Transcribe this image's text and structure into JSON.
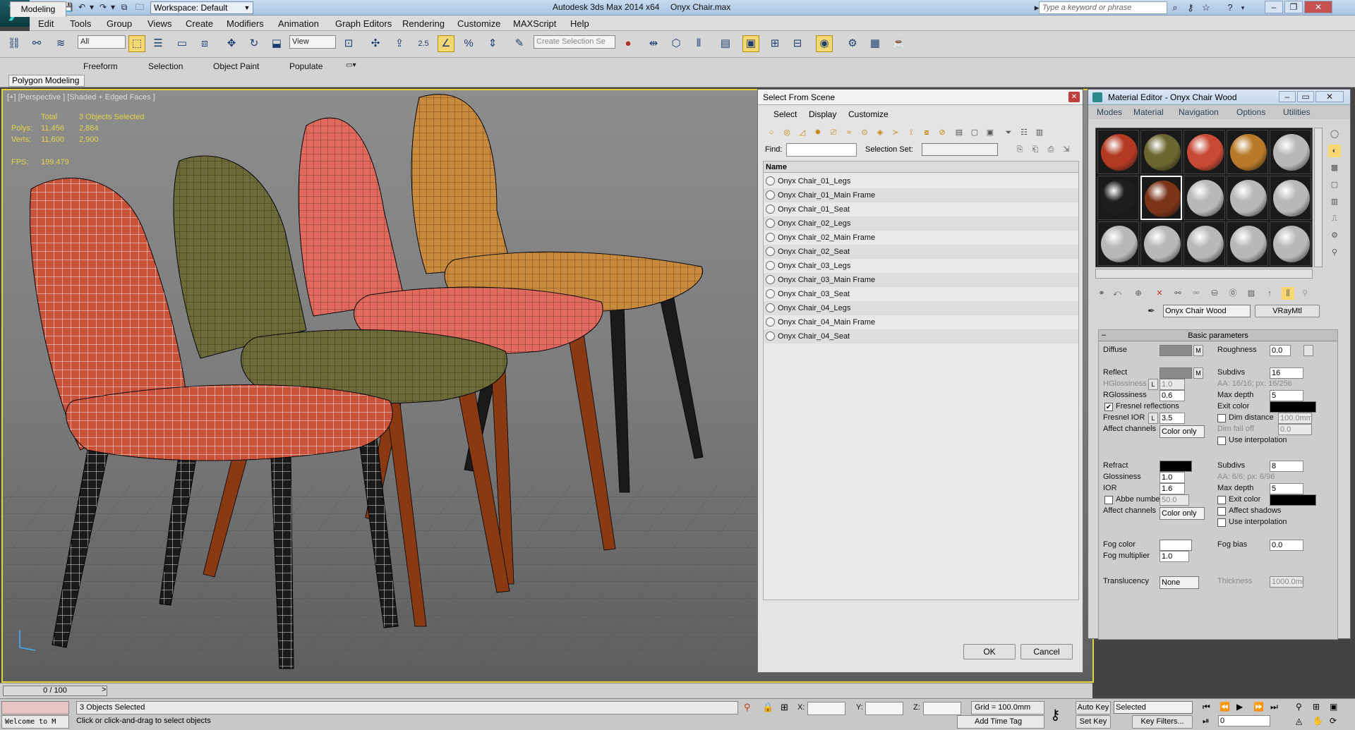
{
  "titlebar": {
    "workspace": "Workspace: Default",
    "app_title": "Autodesk 3ds Max  2014 x64",
    "file_title": "Onyx Chair.max",
    "search_placeholder": "Type a keyword or phrase"
  },
  "menu": [
    "Edit",
    "Tools",
    "Group",
    "Views",
    "Create",
    "Modifiers",
    "Animation",
    "Graph Editors",
    "Rendering",
    "Customize",
    "MAXScript",
    "Help"
  ],
  "toolbar": {
    "filter_value": "All",
    "refcoord_value": "View",
    "snap_value": "2.5",
    "selection_set_placeholder": "Create Selection Se"
  },
  "ribbon": {
    "tabs": [
      "Modeling",
      "Freeform",
      "Selection",
      "Object Paint",
      "Populate"
    ],
    "panel": "Polygon Modeling"
  },
  "viewport": {
    "label": "[+] [Perspective ] [Shaded + Edged Faces ]",
    "stats": {
      "total_label": "Total",
      "total_value": "3 Objects Selected",
      "polys_label": "Polys:",
      "polys_total": "11,456",
      "polys_sel": "2,864",
      "verts_label": "Verts:",
      "verts_total": "11,600",
      "verts_sel": "2,900",
      "fps_label": "FPS:",
      "fps_value": "199.479"
    },
    "colors": {
      "chair1": "#c8523a",
      "chair2": "#6b6a38",
      "chair3": "#e06a5e",
      "chair4": "#c88a3c",
      "legs": "#8a3a12",
      "legs_dark": "#1a1a1a"
    }
  },
  "select_from_scene": {
    "title": "Select From Scene",
    "menu": [
      "Select",
      "Display",
      "Customize"
    ],
    "find_label": "Find:",
    "selection_set_label": "Selection Set:",
    "column_name": "Name",
    "items": [
      "Onyx Chair_01_Legs",
      "Onyx Chair_01_Main Frame",
      "Onyx Chair_01_Seat",
      "Onyx Chair_02_Legs",
      "Onyx Chair_02_Main Frame",
      "Onyx Chair_02_Seat",
      "Onyx Chair_03_Legs",
      "Onyx Chair_03_Main Frame",
      "Onyx Chair_03_Seat",
      "Onyx Chair_04_Legs",
      "Onyx Chair_04_Main Frame",
      "Onyx Chair_04_Seat"
    ],
    "ok": "OK",
    "cancel": "Cancel"
  },
  "material_editor": {
    "title": "Material Editor - Onyx Chair Wood",
    "menu": [
      "Modes",
      "Material",
      "Navigation",
      "Options",
      "Utilities"
    ],
    "material_name": "Onyx Chair Wood",
    "material_type": "VRayMtl",
    "rollout": "Basic parameters",
    "slot_colors": [
      "#b33a22",
      "#6b6630",
      "#c84a36",
      "#b87a2a",
      "#b8b8b8",
      "#1e1e1e",
      "#7a3418",
      "#b8b8b8",
      "#b8b8b8",
      "#b8b8b8",
      "#b8b8b8",
      "#b8b8b8",
      "#b8b8b8",
      "#b8b8b8",
      "#b8b8b8"
    ],
    "params": {
      "diffuse": "Diffuse",
      "roughness": "Roughness",
      "roughness_val": "0.0",
      "reflect": "Reflect",
      "subdivs": "Subdivs",
      "subdivs_val": "16",
      "hglossiness": "HGlossiness",
      "hgloss_val": "1.0",
      "aa_text": "AA: 16/16; px: 16/256",
      "rglossiness": "RGlossiness",
      "rgloss_val": "0.6",
      "max_depth": "Max depth",
      "max_depth_val": "5",
      "fresnel": "Fresnel reflections",
      "exit_color": "Exit color",
      "fresnel_ior": "Fresnel IOR",
      "fresnel_ior_val": "3.5",
      "dim_distance": "Dim distance",
      "dim_distance_val": "100.0mm",
      "affect_channels": "Affect channels",
      "color_only": "Color only",
      "dim_falloff": "Dim fall off",
      "dim_falloff_val": "0.0",
      "use_interp": "Use interpolation",
      "refract": "Refract",
      "refr_subdivs_val": "8",
      "glossiness": "Glossiness",
      "gloss_val": "1.0",
      "refr_aa": "AA: 6/6; px: 6/96",
      "ior": "IOR",
      "ior_val": "1.6",
      "refr_max_depth_val": "5",
      "abbe": "Abbe number",
      "abbe_val": "50.0",
      "refr_exit": "Exit color",
      "affect_shadows": "Affect shadows",
      "fog_color": "Fog color",
      "fog_bias": "Fog bias",
      "fog_bias_val": "0.0",
      "fog_mult": "Fog multiplier",
      "fog_mult_val": "1.0",
      "translucency": "Translucency",
      "transl_val": "None",
      "thickness": "Thickness",
      "thickness_val": "1000.0mi"
    }
  },
  "timeline": {
    "frame": "0 / 100"
  },
  "status": {
    "selection": "3 Objects Selected",
    "prompt": "Click or click-and-drag to select objects",
    "maxscript": "Welcome to M",
    "x_label": "X:",
    "y_label": "Y:",
    "z_label": "Z:",
    "grid": "Grid = 100.0mm",
    "add_time_tag": "Add Time Tag",
    "auto_key": "Auto Key",
    "set_key": "Set Key",
    "key_filter_value": "Selected",
    "key_filters": "Key Filters...",
    "frame_value": "0"
  }
}
